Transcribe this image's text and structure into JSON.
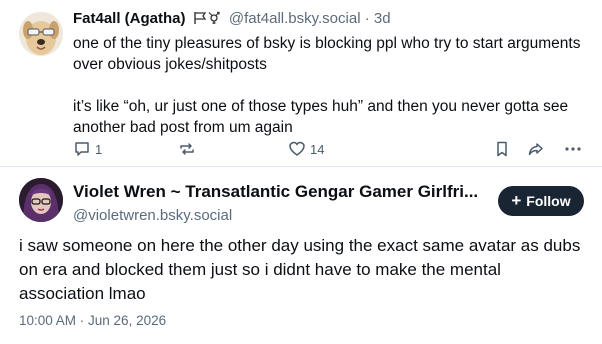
{
  "post1": {
    "display_name": "Fat4all (Agatha)",
    "handle": "@fat4all.bsky.social",
    "separator": "·",
    "time": "3d",
    "paragraphs": [
      "one of the tiny pleasures of bsky is blocking ppl who try to start arguments over obvious jokes/shitposts",
      "it’s like “oh, ur just one of those types huh” and then you never gotta see another bad post from um again"
    ],
    "reply_count": "1",
    "like_count": "14"
  },
  "post2": {
    "display_name": "Violet Wren ~ Transatlantic Gengar Gamer Girlfri...",
    "handle": "@violetwren.bsky.social",
    "follow_label": "Follow",
    "follow_icon": "+",
    "text": "i saw someone on here the other day using the exact same avatar as dubs on era and blocked them just so i didnt have to make the mental association lmao",
    "timestamp": "10:00 AM · Jun 26, 2026"
  },
  "colors": {
    "text": "#0b0f14",
    "muted": "#5b6b7b",
    "follow_bg": "#1a2533",
    "divider": "#e4e9ef"
  }
}
